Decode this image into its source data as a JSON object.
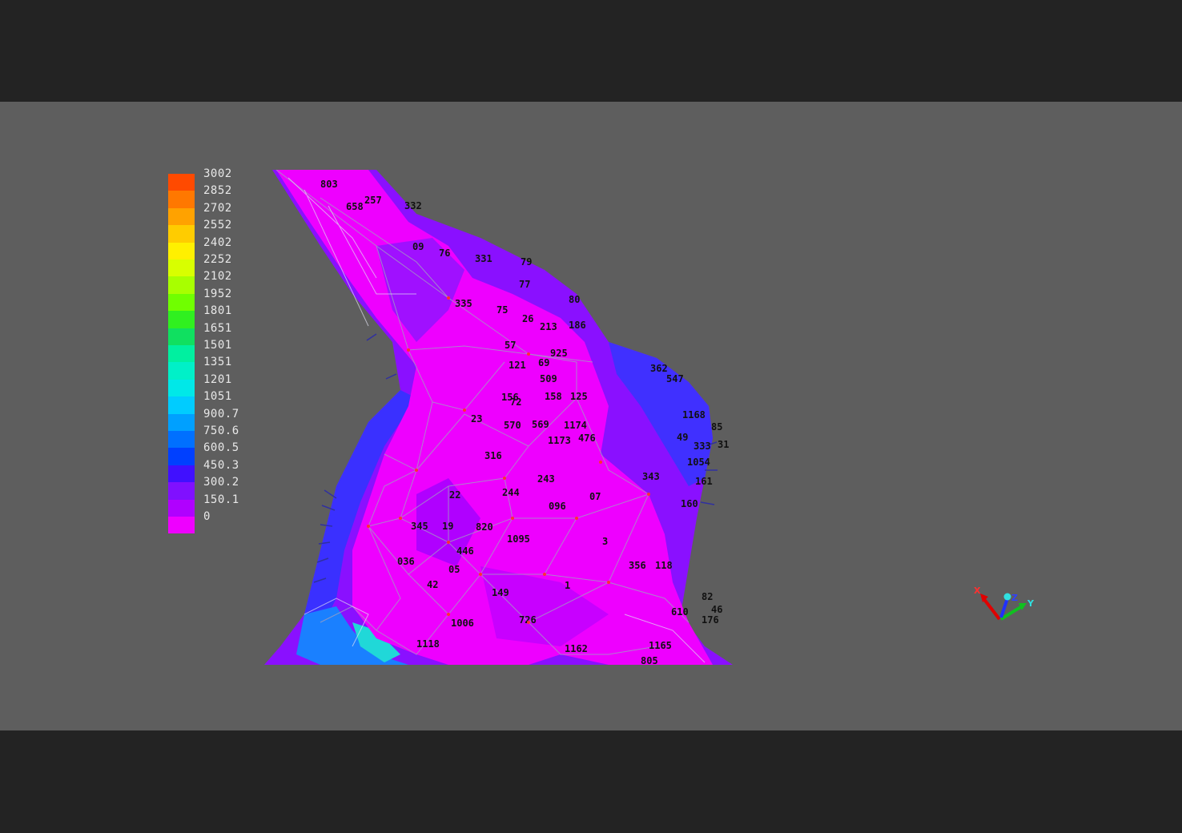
{
  "legend": {
    "entries": [
      {
        "label": "3002",
        "color": "#ff4a00"
      },
      {
        "label": "2852",
        "color": "#ff7800"
      },
      {
        "label": "2702",
        "color": "#ffa200"
      },
      {
        "label": "2552",
        "color": "#ffcc00"
      },
      {
        "label": "2402",
        "color": "#fff000"
      },
      {
        "label": "2252",
        "color": "#d8ff00"
      },
      {
        "label": "2102",
        "color": "#a8ff00"
      },
      {
        "label": "1952",
        "color": "#70ff00"
      },
      {
        "label": "1801",
        "color": "#30f020"
      },
      {
        "label": "1651",
        "color": "#10e060"
      },
      {
        "label": "1501",
        "color": "#00f0a0"
      },
      {
        "label": "1351",
        "color": "#00f0c8"
      },
      {
        "label": "1201",
        "color": "#00e8e8"
      },
      {
        "label": "1051",
        "color": "#00ccff"
      },
      {
        "label": "900.7",
        "color": "#00a0ff"
      },
      {
        "label": "750.6",
        "color": "#0070ff"
      },
      {
        "label": "600.5",
        "color": "#0040ff"
      },
      {
        "label": "450.3",
        "color": "#4010ff"
      },
      {
        "label": "300.2",
        "color": "#8010ff"
      },
      {
        "label": "150.1",
        "color": "#b000ff"
      },
      {
        "label": "0",
        "color": "#ee00ff"
      }
    ]
  },
  "node_labels": [
    {
      "text": "803"
    },
    {
      "text": "658"
    },
    {
      "text": "257"
    },
    {
      "text": "332"
    },
    {
      "text": "09"
    },
    {
      "text": "76"
    },
    {
      "text": "331"
    },
    {
      "text": "79"
    },
    {
      "text": "77"
    },
    {
      "text": "80"
    },
    {
      "text": "335"
    },
    {
      "text": "75"
    },
    {
      "text": "26"
    },
    {
      "text": "213"
    },
    {
      "text": "186"
    },
    {
      "text": "57"
    },
    {
      "text": "925"
    },
    {
      "text": "121"
    },
    {
      "text": "69"
    },
    {
      "text": "509"
    },
    {
      "text": "362"
    },
    {
      "text": "547"
    },
    {
      "text": "156"
    },
    {
      "text": "72"
    },
    {
      "text": "158"
    },
    {
      "text": "125"
    },
    {
      "text": "23"
    },
    {
      "text": "570"
    },
    {
      "text": "569"
    },
    {
      "text": "1174"
    },
    {
      "text": "1173"
    },
    {
      "text": "476"
    },
    {
      "text": "316"
    },
    {
      "text": "243"
    },
    {
      "text": "244"
    },
    {
      "text": "22"
    },
    {
      "text": "096"
    },
    {
      "text": "07"
    },
    {
      "text": "345"
    },
    {
      "text": "19"
    },
    {
      "text": "820"
    },
    {
      "text": "1095"
    },
    {
      "text": "3"
    },
    {
      "text": "446"
    },
    {
      "text": "036"
    },
    {
      "text": "05"
    },
    {
      "text": "42"
    },
    {
      "text": "149"
    },
    {
      "text": "1"
    },
    {
      "text": "356"
    },
    {
      "text": "118"
    },
    {
      "text": "726"
    },
    {
      "text": "1006"
    },
    {
      "text": "1118"
    },
    {
      "text": "1162"
    },
    {
      "text": "610"
    },
    {
      "text": "1165"
    },
    {
      "text": "805"
    },
    {
      "text": "333"
    },
    {
      "text": "31"
    },
    {
      "text": "1054"
    },
    {
      "text": "161"
    },
    {
      "text": "160"
    },
    {
      "text": "85"
    },
    {
      "text": "343"
    },
    {
      "text": "1168"
    },
    {
      "text": "49"
    },
    {
      "text": "46"
    },
    {
      "text": "176"
    },
    {
      "text": "82"
    }
  ],
  "axis": {
    "x": "X",
    "y": "Y",
    "z": "Z"
  },
  "colors": {
    "background_frame": "#232323",
    "viewport": "#5e5e5e",
    "mesh_primary": "#ee00ff",
    "mesh_secondary": "#9010ff",
    "mesh_edge": "#3a20ff"
  }
}
